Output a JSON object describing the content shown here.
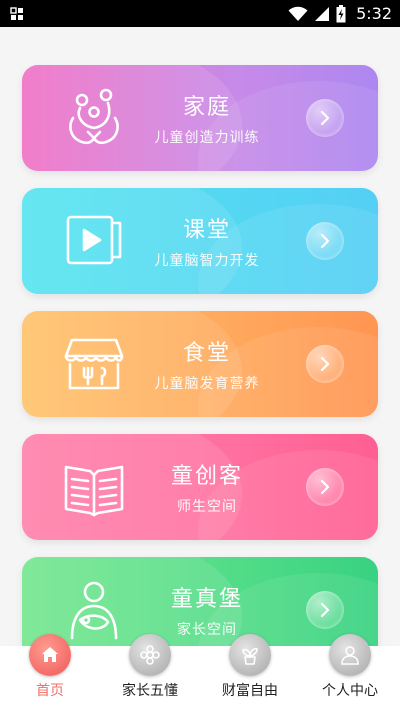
{
  "status_bar": {
    "time": "5:32"
  },
  "cards": [
    {
      "title": "家庭",
      "subtitle": "儿童创造力训练",
      "icon": "family-icon"
    },
    {
      "title": "课堂",
      "subtitle": "儿童脑智力开发",
      "icon": "video-play-icon"
    },
    {
      "title": "食堂",
      "subtitle": "儿童脑发育营养",
      "icon": "canteen-icon"
    },
    {
      "title": "童创客",
      "subtitle": "师生空间",
      "icon": "book-icon"
    },
    {
      "title": "童真堡",
      "subtitle": "家长空间",
      "icon": "parent-baby-icon"
    }
  ],
  "tabbar": [
    {
      "label": "首页",
      "icon": "home-icon",
      "active": true
    },
    {
      "label": "家长五懂",
      "icon": "flower-icon",
      "active": false
    },
    {
      "label": "财富自由",
      "icon": "plant-icon",
      "active": false
    },
    {
      "label": "个人中心",
      "icon": "user-icon",
      "active": false
    }
  ],
  "colors": {
    "active_tab": "#f0706a",
    "card_family": "#d07fe0",
    "card_classroom": "#54d7f2",
    "card_canteen": "#ffa85c",
    "card_maker": "#ff6f9f",
    "card_castle": "#52dc87"
  }
}
